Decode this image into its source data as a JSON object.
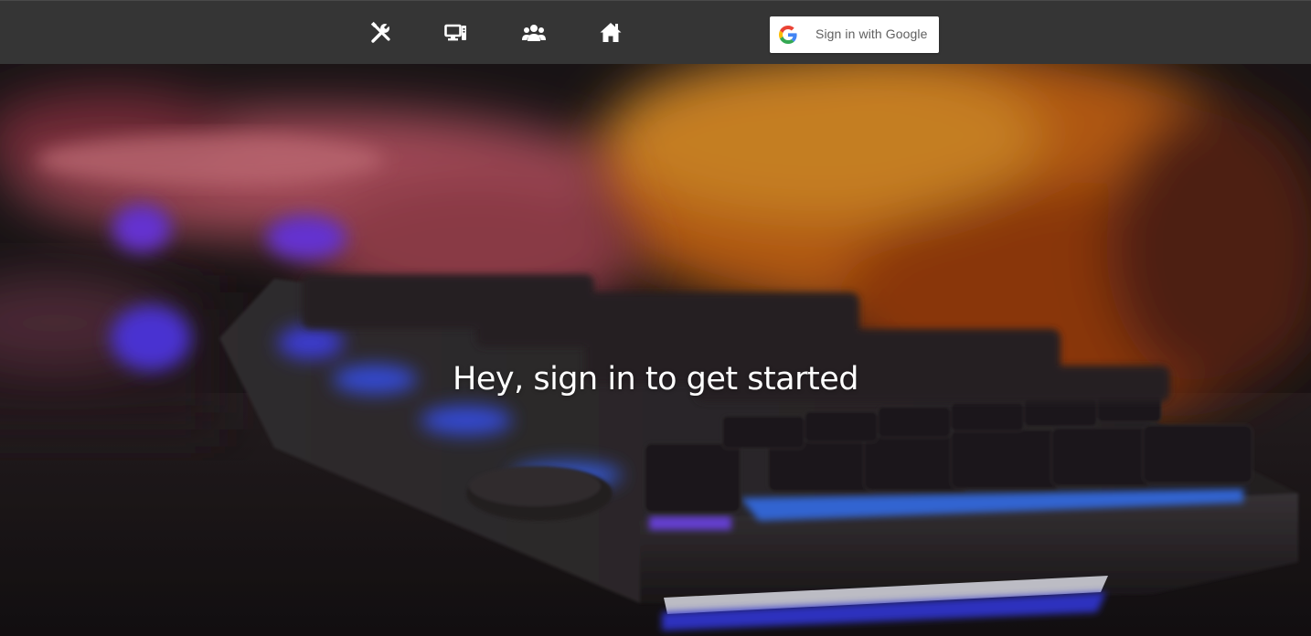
{
  "nav": {
    "icons": [
      {
        "name": "tools-icon"
      },
      {
        "name": "devices-icon"
      },
      {
        "name": "users-icon"
      },
      {
        "name": "home-icon"
      }
    ],
    "icon_color": "#ffffff",
    "background": "#353535"
  },
  "auth": {
    "google_button_label": "Sign in with Google",
    "icon": "google-g-icon"
  },
  "hero": {
    "title": "Hey, sign in to get started",
    "image": "backlit-mechanical-keyboard-photo"
  }
}
